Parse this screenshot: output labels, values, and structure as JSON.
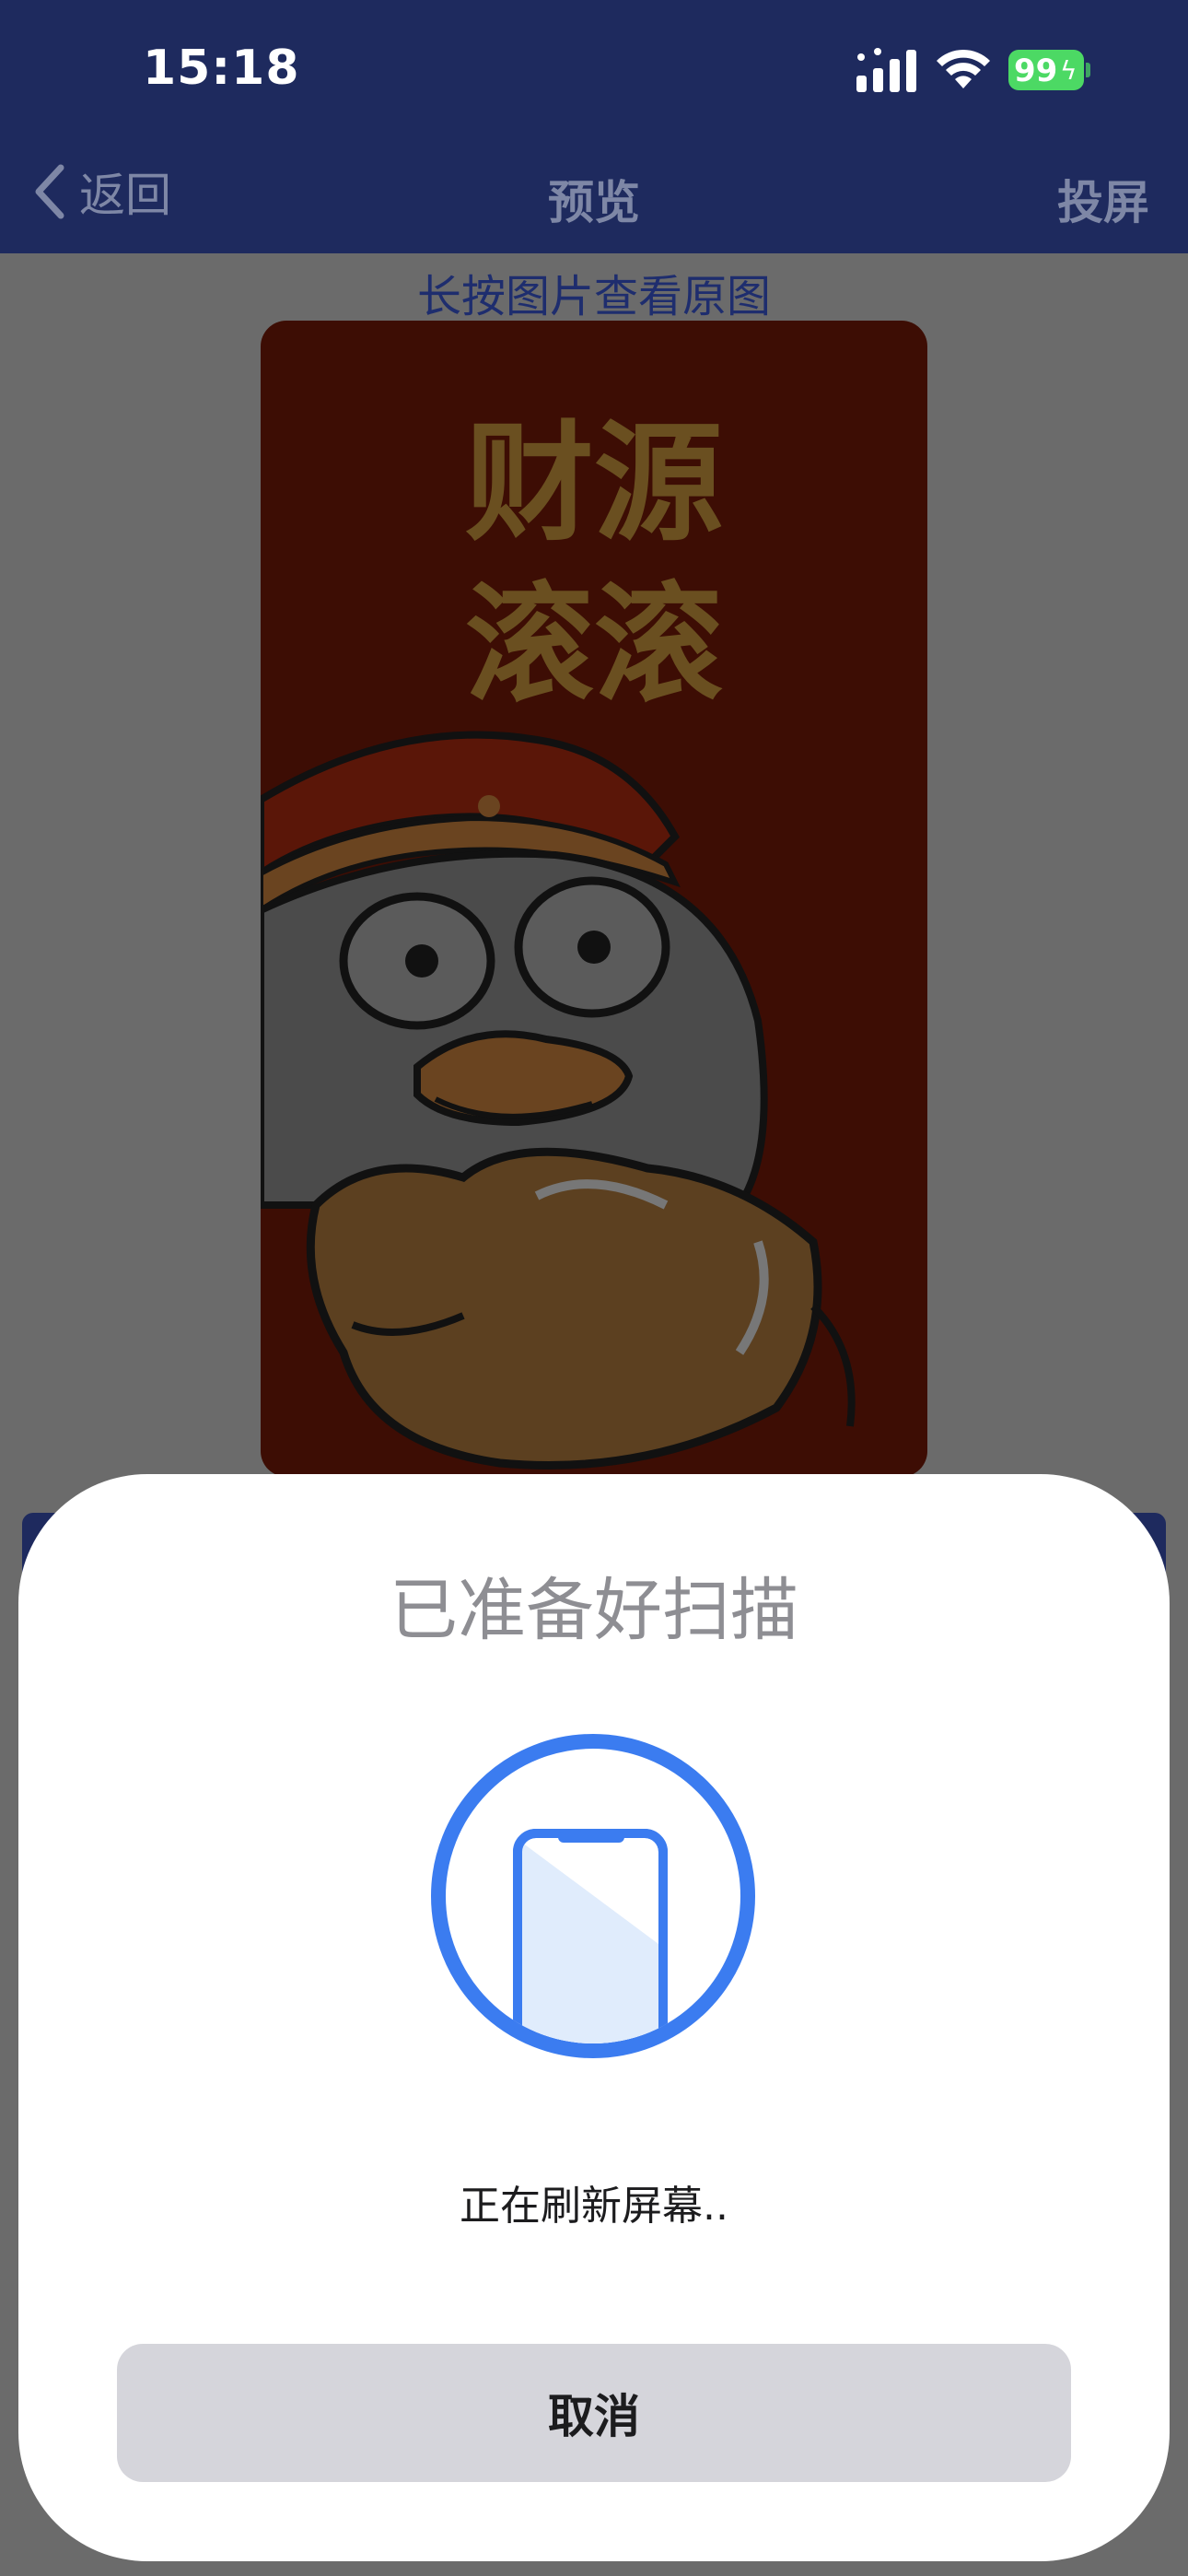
{
  "status_bar": {
    "time": "15:18",
    "battery": "99"
  },
  "nav": {
    "back_label": "返回",
    "title": "预览",
    "cast_label": "投屏"
  },
  "preview": {
    "hint": "长按图片查看原图",
    "image_caption": [
      "财源",
      "滚滚"
    ]
  },
  "sheet": {
    "title": "已准备好扫描",
    "status": "正在刷新屏幕..",
    "cancel_label": "取消"
  },
  "colors": {
    "header": "#1e2a5e",
    "overlay": "#6b6b6b",
    "accent": "#3b7cf0",
    "button_bg": "#d5d5db"
  }
}
